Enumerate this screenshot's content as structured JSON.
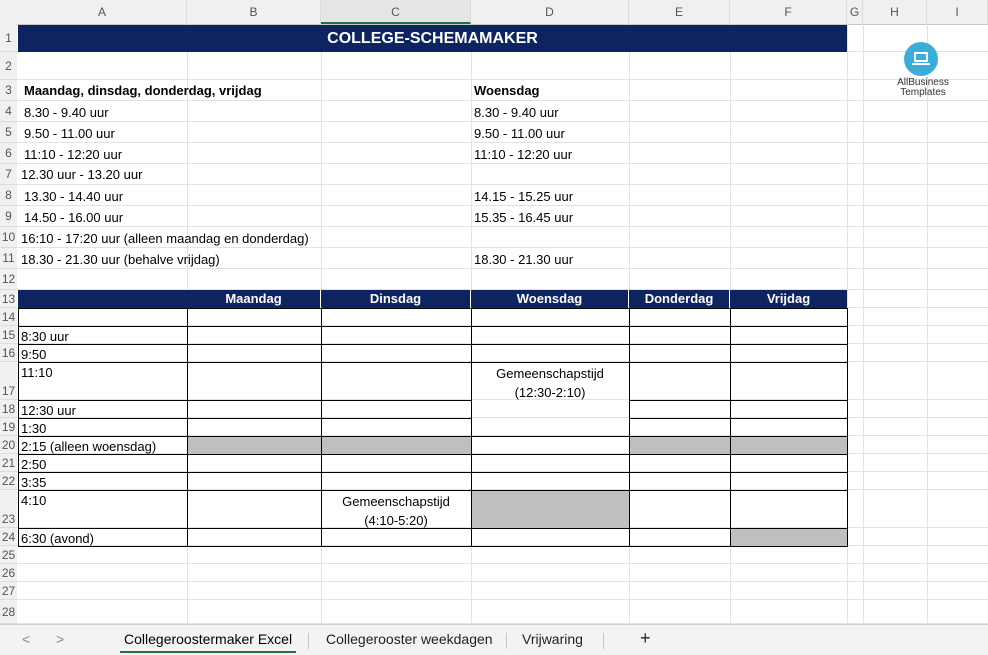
{
  "columns": [
    "A",
    "B",
    "C",
    "D",
    "E",
    "F",
    "G",
    "H",
    "I"
  ],
  "rows": [
    "1",
    "2",
    "3",
    "4",
    "5",
    "6",
    "7",
    "8",
    "9",
    "10",
    "11",
    "12",
    "13",
    "14",
    "15",
    "16",
    "17",
    "18",
    "19",
    "20",
    "21",
    "22",
    "23",
    "24",
    "25",
    "26",
    "27",
    "28"
  ],
  "title": "COLLEGE-SCHEMAMAKER",
  "logo": {
    "line1": "AllBusiness",
    "line2": "Templates"
  },
  "left_schedule": {
    "heading": "Maandag, dinsdag, donderdag, vrijdag",
    "slots": [
      "8.30 - 9.40 uur",
      "9.50 - 11.00 uur",
      "11:10 - 12:20 uur",
      "12.30 uur - 13.20 uur",
      "13.30 - 14.40 uur",
      "14.50 - 16.00 uur",
      "16:10 - 17:20 uur (alleen maandag en donderdag)",
      "18.30 - 21.30 uur (behalve vrijdag)"
    ]
  },
  "right_schedule": {
    "heading": "Woensdag",
    "slots": [
      "8.30 - 9.40 uur",
      "9.50 - 11.00 uur",
      "11:10 - 12:20 uur",
      "14.15 - 15.25 uur",
      "15.35 - 16.45 uur",
      "18.30 - 21.30 uur"
    ]
  },
  "table": {
    "days": [
      "Maandag",
      "Dinsdag",
      "Woensdag",
      "Donderdag",
      "Vrijdag"
    ],
    "times": [
      "8:30 uur",
      "9:50",
      "11:10",
      "12:30 uur",
      "1:30",
      "2:15 (alleen woensdag)",
      "2:50",
      "3:35",
      "4:10",
      "6:30 (avond)"
    ],
    "community_wed": {
      "line1": "Gemeenschapstijd",
      "line2": "(12:30-2:10)"
    },
    "community_tue": {
      "line1": "Gemeenschapstijd",
      "line2": "(4:10-5:20)"
    }
  },
  "colors": {
    "header_navy": "#0d2461",
    "shade_gray": "#bfbfbf",
    "excel_green": "#217346"
  },
  "sheet_tabs": [
    "Collegeroostermaker Excel",
    "Collegerooster weekdagen",
    "Vrijwaring"
  ],
  "active_tab": "Collegeroostermaker Excel",
  "add_sheet": "+",
  "nav_prev": "<",
  "nav_next": ">"
}
